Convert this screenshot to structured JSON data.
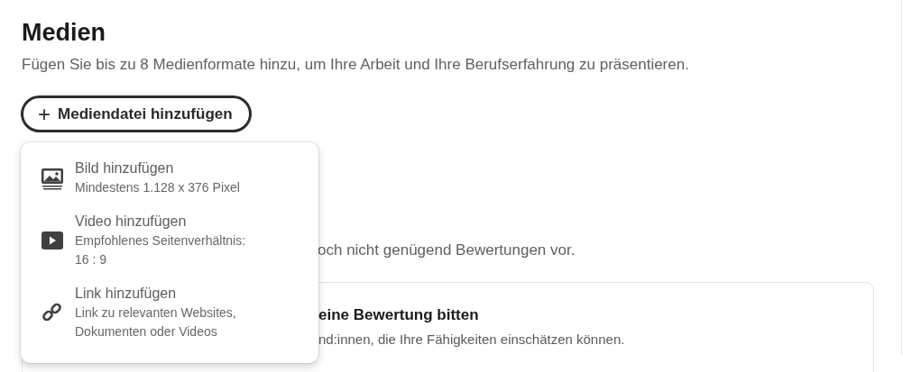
{
  "section": {
    "title": "Medien",
    "description": "Fügen Sie bis zu 8 Medienformate hinzu, um Ihre Arbeit und Ihre Berufserfahrung zu präsentieren.",
    "add_button": {
      "icon": "+",
      "label": "Mediendatei hinzufügen",
      "expanded": true
    }
  },
  "menu": {
    "items": [
      {
        "kind": "image",
        "title": "Bild hinzufügen",
        "subtitle": "Mindestens 1.128 x 376 Pixel"
      },
      {
        "kind": "video",
        "title": "Video hinzufügen",
        "subtitle": "Empfohlenes Seitenverhältnis: 16 : 9"
      },
      {
        "kind": "link",
        "title": "Link hinzufügen",
        "subtitle": "Link zu relevanten Websites, Dokumenten oder Videos"
      }
    ]
  },
  "ratings_note": "och nicht genügend Bewertungen vor.",
  "rating_card": {
    "title": "eine Bewertung bitten",
    "text": "nd:innen, die Ihre Fähigkeiten einschätzen können."
  }
}
